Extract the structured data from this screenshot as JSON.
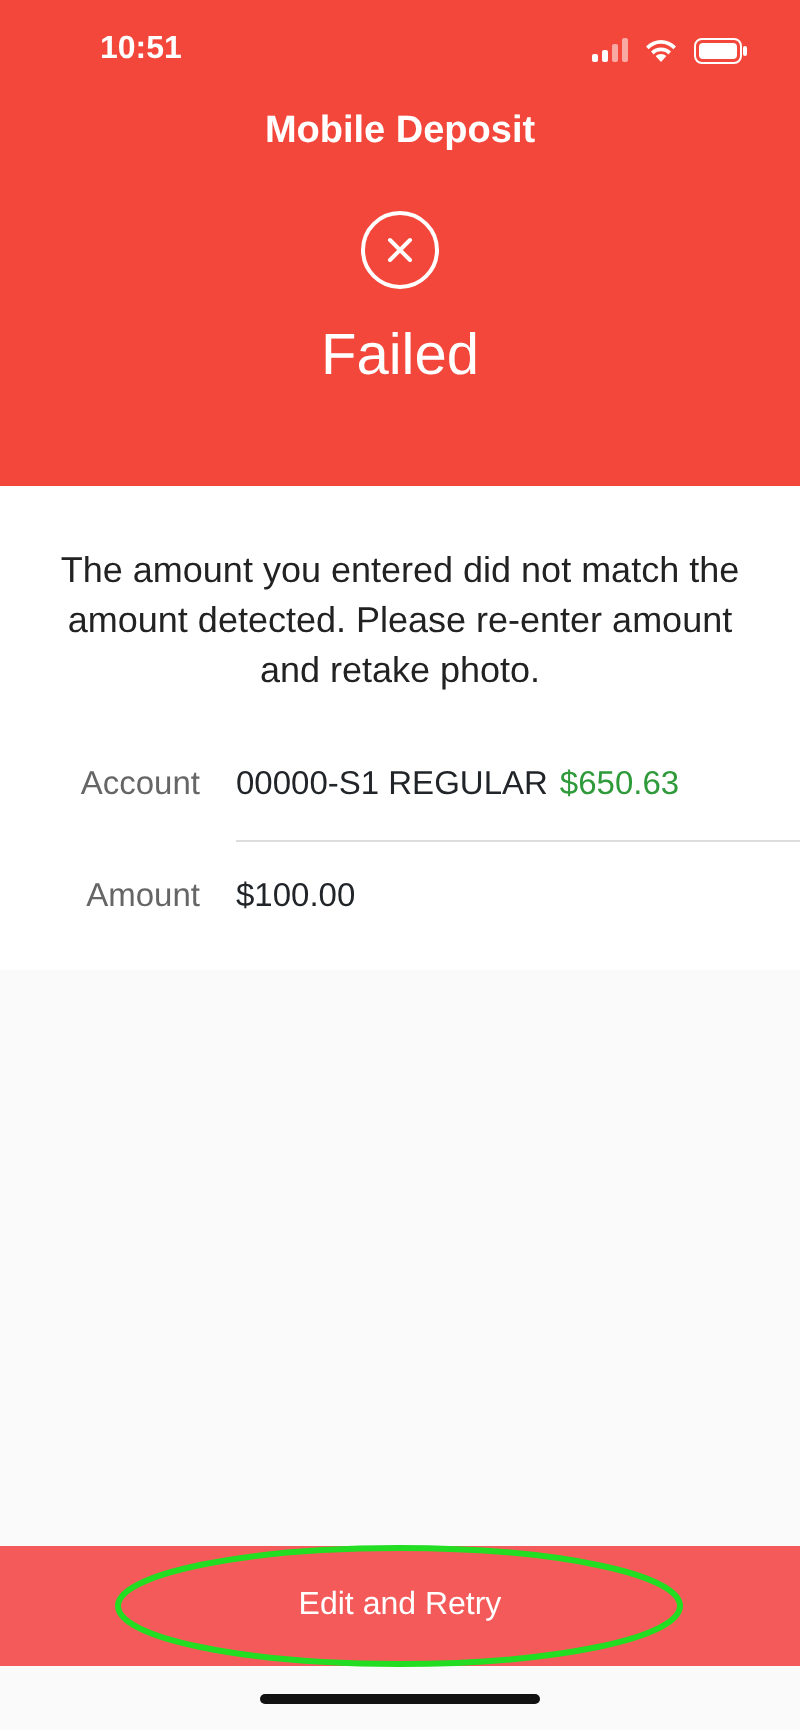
{
  "status_bar": {
    "time": "10:51"
  },
  "header": {
    "title": "Mobile Deposit",
    "status": "Failed"
  },
  "message": "The amount you entered did not match the amount detected. Please re-enter amount and retake photo.",
  "fields": [
    {
      "label": "Account",
      "value": "00000-S1 REGULAR",
      "balance": "$650.63"
    },
    {
      "label": "Amount",
      "value": "$100.00"
    }
  ],
  "button": {
    "label": "Edit and Retry",
    "highlighted": true
  }
}
